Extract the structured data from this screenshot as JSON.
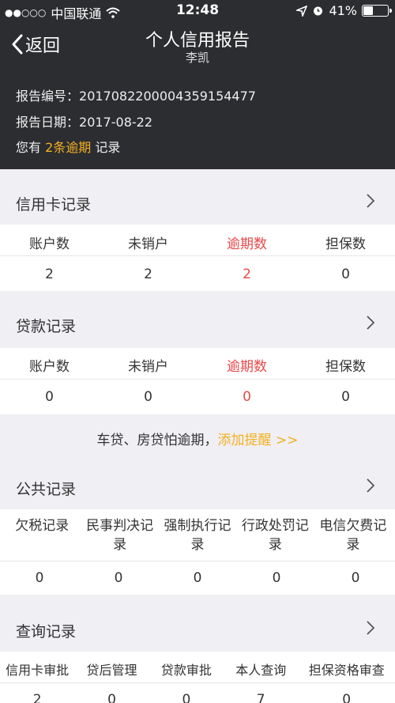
{
  "status_bar": {
    "carrier": "中国联通",
    "time": "12:48",
    "battery": "41%",
    "battery_level": 41
  },
  "nav": {
    "back_label": "返回",
    "title": "个人信用报告",
    "subtitle": "李凯"
  },
  "report": {
    "number_label": "报告编号：",
    "number": "2017082200004359154477",
    "date_label": "报告日期：",
    "date": "2017-08-22",
    "overdue_prefix": "您有 ",
    "overdue_highlight": "2条逾期",
    "overdue_suffix": " 记录"
  },
  "credit_card": {
    "title": "信用卡记录",
    "headers": [
      "账户数",
      "未销户",
      "逾期数",
      "担保数"
    ],
    "values": [
      "2",
      "2",
      "2",
      "0"
    ]
  },
  "loan": {
    "title": "贷款记录",
    "headers": [
      "账户数",
      "未销户",
      "逾期数",
      "担保数"
    ],
    "values": [
      "0",
      "0",
      "0",
      "0"
    ]
  },
  "promo": {
    "text": "车贷、房贷怕逾期，",
    "link": "添加提醒 >>"
  },
  "public_record": {
    "title": "公共记录",
    "headers": [
      "欠税记录",
      "民事判决记录",
      "强制执行记录",
      "行政处罚记录",
      "电信欠费记录"
    ],
    "values": [
      "0",
      "0",
      "0",
      "0",
      "0"
    ]
  },
  "query_record": {
    "title": "查询记录",
    "headers": [
      "信用卡审批",
      "贷后管理",
      "贷款审批",
      "本人查询",
      "担保资格审查"
    ],
    "values": [
      "2",
      "0",
      "0",
      "7",
      "0"
    ]
  },
  "colors": {
    "header_bg": "#2b2d30",
    "highlight": "#f5b021",
    "overdue": "#e8484a"
  }
}
